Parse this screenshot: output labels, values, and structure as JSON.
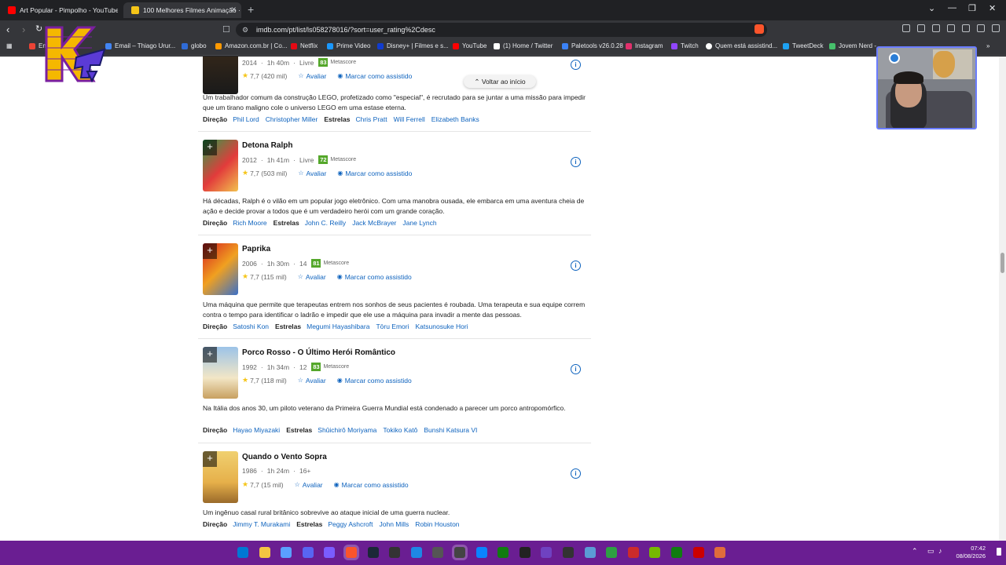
{
  "browser": {
    "tabs": [
      {
        "label": "Art Popular - Pimpolho - YouTube",
        "color": "#ff0000"
      },
      {
        "label": "100 Melhores Filmes Animação ·",
        "color": "#f5c518"
      }
    ],
    "url": "imdb.com/pt/list/ls058278016/?sort=user_rating%2Cdesc",
    "bookmarks": [
      {
        "label": "Em",
        "color": "#ea4335"
      },
      {
        "label": "Email – Thiago Urur...",
        "color": "#4285f4"
      },
      {
        "label": "globo",
        "color": "#2f6bd6"
      },
      {
        "label": "Amazon.com.br | Co...",
        "color": "#ff9900"
      },
      {
        "label": "Netflix",
        "color": "#e50914"
      },
      {
        "label": "Prime Video",
        "color": "#1a98ff"
      },
      {
        "label": "Disney+ | Filmes e s...",
        "color": "#113ccf"
      },
      {
        "label": "YouTube",
        "color": "#ff0000"
      },
      {
        "label": "(1) Home / Twitter",
        "color": "#ffffff"
      },
      {
        "label": "Paletools v26.0.28",
        "color": "#3b82f6"
      },
      {
        "label": "Instagram",
        "color": "#e1306c"
      },
      {
        "label": "Twitch",
        "color": "#9146ff"
      },
      {
        "label": "Quem está assistind...",
        "color": "#ffffff"
      },
      {
        "label": "TweetDeck",
        "color": "#1da1f2"
      },
      {
        "label": "Jovem Nerd -",
        "color": "#46c06b"
      }
    ]
  },
  "page": {
    "back_to_top": "Voltar ao início",
    "rate_label": "Avaliar",
    "watched_label": "Marcar como assistido",
    "metascore_label": "Metascore",
    "direction_label": "Direção",
    "stars_label": "Estrelas",
    "movies": [
      {
        "title": "",
        "year": "2014",
        "runtime": "1h 40m",
        "cert": "Livre",
        "metascore": "83",
        "rating": "7,7",
        "votes": "(420 mil)",
        "plot": "Um trabalhador comum da construção LEGO, profetizado como \"especial\", é recrutado para se juntar a uma missão para impedir que um tirano maligno cole o universo LEGO em uma estase eterna.",
        "directors": [
          "Phil Lord",
          "Christopher Miller"
        ],
        "stars": [
          "Chris Pratt",
          "Will Ferrell",
          "Elizabeth Banks"
        ]
      },
      {
        "title": "Detona Ralph",
        "year": "2012",
        "runtime": "1h 41m",
        "cert": "Livre",
        "metascore": "72",
        "rating": "7,7",
        "votes": "(503 mil)",
        "plot": "Há décadas, Ralph é o vilão em um popular jogo eletrônico. Com uma manobra ousada, ele embarca em uma aventura cheia de ação e decide provar a todos que é um verdadeiro herói com um grande coração.",
        "directors": [
          "Rich Moore"
        ],
        "stars": [
          "John C. Reilly",
          "Jack McBrayer",
          "Jane Lynch"
        ]
      },
      {
        "title": "Paprika",
        "year": "2006",
        "runtime": "1h 30m",
        "cert": "14",
        "metascore": "81",
        "rating": "7,7",
        "votes": "(115 mil)",
        "plot": "Uma máquina que permite que terapeutas entrem nos sonhos de seus pacientes é roubada. Uma terapeuta e sua equipe correm contra o tempo para identificar o ladrão e impedir que ele use a máquina para invadir a mente das pessoas.",
        "directors": [
          "Satoshi Kon"
        ],
        "stars": [
          "Megumi Hayashibara",
          "Tōru Emori",
          "Katsunosuke Hori"
        ]
      },
      {
        "title": "Porco Rosso - O Último Herói Romântico",
        "year": "1992",
        "runtime": "1h 34m",
        "cert": "12",
        "metascore": "83",
        "rating": "7,7",
        "votes": "(118 mil)",
        "plot": "Na Itália dos anos 30, um piloto veterano da Primeira Guerra Mundial está condenado a parecer um porco antropomórfico.",
        "directors": [
          "Hayao Miyazaki"
        ],
        "stars": [
          "Shûichirô Moriyama",
          "Tokiko Katô",
          "Bunshi Katsura VI"
        ]
      },
      {
        "title": "Quando o Vento Sopra",
        "year": "1986",
        "runtime": "1h 24m",
        "cert": "16+",
        "metascore": "",
        "rating": "7,7",
        "votes": "(15 mil)",
        "plot": "Um ingênuo casal rural britânico sobrevive ao ataque inicial de uma guerra nuclear.",
        "directors": [
          "Jimmy T. Murakami"
        ],
        "stars": [
          "Peggy Ashcroft",
          "John Mills",
          "Robin Houston"
        ]
      }
    ]
  },
  "taskbar": {
    "time": "07:42",
    "date": "08/08/2026",
    "icon_colors": [
      "#0078d4",
      "#f4c542",
      "#5aa0ff",
      "#5865f2",
      "#7a5cff",
      "#fb542b",
      "#1b2838",
      "#333333",
      "#1e88e5",
      "#555555",
      "#444444",
      "#0a84ff",
      "#107c10",
      "#222222",
      "#6f42c1",
      "#333333",
      "#5b9bd5",
      "#2ea043",
      "#cc2b2b",
      "#76b900",
      "#107c10",
      "#cc0000",
      "#e06c3c"
    ]
  }
}
